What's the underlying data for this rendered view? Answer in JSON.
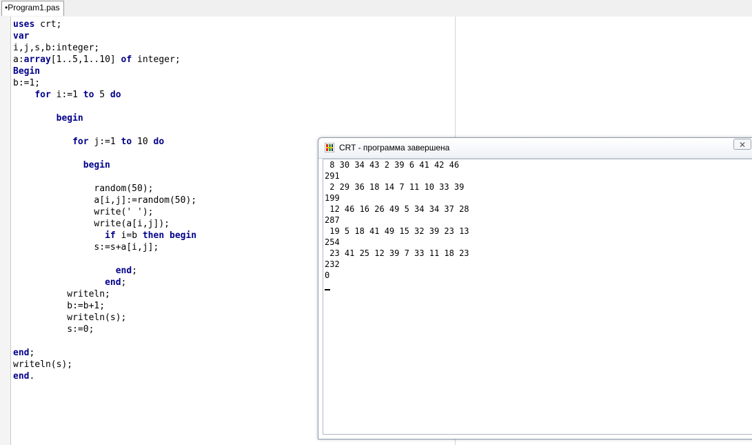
{
  "tab": {
    "label": "•Program1.pas"
  },
  "code_lines": [
    [
      {
        "t": "uses",
        "k": true
      },
      {
        "t": " crt;"
      }
    ],
    [
      {
        "t": "var",
        "k": true
      }
    ],
    [
      {
        "t": "i,j,s,b:integer;"
      }
    ],
    [
      {
        "t": "a:"
      },
      {
        "t": "array",
        "k": true
      },
      {
        "t": "[1..5,1..10] "
      },
      {
        "t": "of",
        "k": true
      },
      {
        "t": " integer;"
      }
    ],
    [
      {
        "t": "Begin",
        "k": true
      }
    ],
    [
      {
        "t": "b:=1;"
      }
    ],
    [
      {
        "t": "    "
      },
      {
        "t": "for",
        "k": true
      },
      {
        "t": " i:=1 "
      },
      {
        "t": "to",
        "k": true
      },
      {
        "t": " 5 "
      },
      {
        "t": "do",
        "k": true
      }
    ],
    [],
    [
      {
        "t": "        "
      },
      {
        "t": "begin",
        "k": true
      }
    ],
    [],
    [
      {
        "t": "           "
      },
      {
        "t": "for",
        "k": true
      },
      {
        "t": " j:=1 "
      },
      {
        "t": "to",
        "k": true
      },
      {
        "t": " 10 "
      },
      {
        "t": "do",
        "k": true
      }
    ],
    [],
    [
      {
        "t": "             "
      },
      {
        "t": "begin",
        "k": true
      }
    ],
    [],
    [
      {
        "t": "               random(50);"
      }
    ],
    [
      {
        "t": "               a[i,j]:=random(50);"
      }
    ],
    [
      {
        "t": "               write(' ');"
      }
    ],
    [
      {
        "t": "               write(a[i,j]);"
      }
    ],
    [
      {
        "t": "                 "
      },
      {
        "t": "if",
        "k": true
      },
      {
        "t": " i=b "
      },
      {
        "t": "then",
        "k": true
      },
      {
        "t": " "
      },
      {
        "t": "begin",
        "k": true
      }
    ],
    [
      {
        "t": "               s:=s+a[i,j];"
      }
    ],
    [],
    [
      {
        "t": "                   "
      },
      {
        "t": "end",
        "k": true
      },
      {
        "t": ";"
      }
    ],
    [
      {
        "t": "                 "
      },
      {
        "t": "end",
        "k": true
      },
      {
        "t": ";"
      }
    ],
    [
      {
        "t": "          writeln;"
      }
    ],
    [
      {
        "t": "          b:=b+1;"
      }
    ],
    [
      {
        "t": "          writeln(s);"
      }
    ],
    [
      {
        "t": "          s:=0;"
      }
    ],
    [],
    [
      {
        "t": "end",
        "k": true
      },
      {
        "t": ";"
      }
    ],
    [
      {
        "t": "writeln(s);"
      }
    ],
    [
      {
        "t": "end",
        "k": true
      },
      {
        "t": "."
      }
    ]
  ],
  "crt": {
    "title": "CRT - программа завершена",
    "close_label": "✕",
    "output_lines": [
      " 8 30 34 43 2 39 6 41 42 46",
      "291",
      " 2 29 36 18 14 7 11 10 33 39",
      "199",
      " 12 46 16 26 49 5 34 34 37 28",
      "287",
      " 19 5 18 41 49 15 32 39 23 13",
      "254",
      " 23 41 25 12 39 7 33 11 18 23",
      "232",
      "0"
    ]
  }
}
